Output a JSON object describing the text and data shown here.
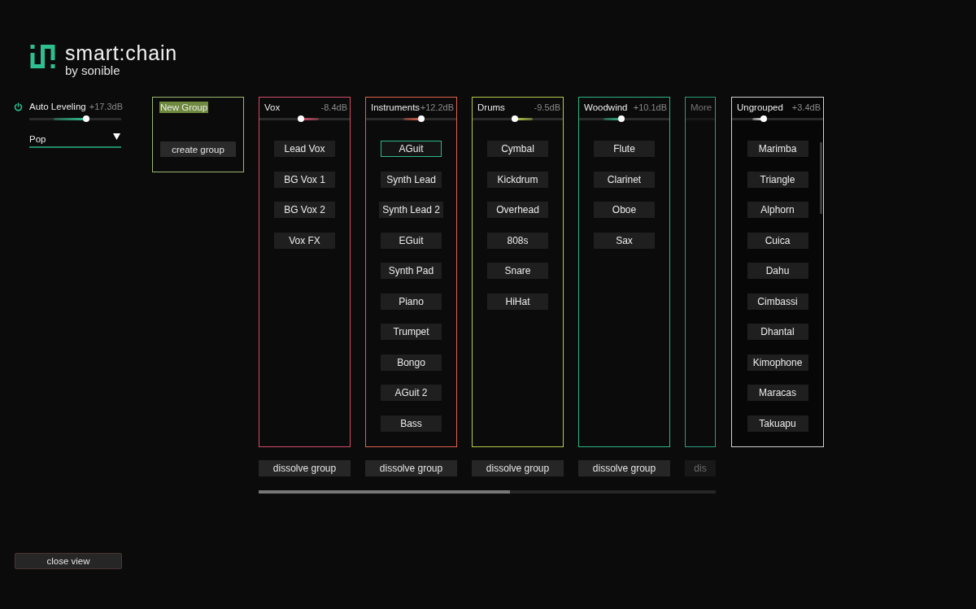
{
  "logo": {
    "title": "smart:chain",
    "byline": "by sonible"
  },
  "auto_leveling": {
    "label": "Auto Leveling",
    "on": true,
    "reading": "+17.3dB",
    "level": 0.62,
    "trail_left": true
  },
  "preset": {
    "value": "Pop"
  },
  "new_group": {
    "name": "New Group",
    "name_highlighted": true,
    "button": "create group"
  },
  "groups": [
    {
      "name": "Vox",
      "reading": "-8.4dB",
      "level": 0.46,
      "trail_left": false,
      "color": "#d04e68",
      "items": [
        {
          "label": "Lead Vox",
          "selected": false
        },
        {
          "label": "BG Vox 1",
          "selected": false
        },
        {
          "label": "BG Vox 2",
          "selected": false
        },
        {
          "label": "Vox FX",
          "selected": false
        }
      ],
      "dissolve": "dissolve group"
    },
    {
      "name": "Instruments",
      "reading": "+12.2dB",
      "level": 0.61,
      "trail_left": true,
      "color": "#e0604c",
      "items": [
        {
          "label": "AGuit",
          "selected": true
        },
        {
          "label": "Synth Lead",
          "selected": false
        },
        {
          "label": "Synth Lead 2",
          "selected": false
        },
        {
          "label": "EGuit",
          "selected": false
        },
        {
          "label": "Synth Pad",
          "selected": false
        },
        {
          "label": "Piano",
          "selected": false
        },
        {
          "label": "Trumpet",
          "selected": false
        },
        {
          "label": "Bongo",
          "selected": false
        },
        {
          "label": "AGuit 2",
          "selected": false
        },
        {
          "label": "Bass",
          "selected": false
        }
      ],
      "dissolve": "dissolve group"
    },
    {
      "name": "Drums",
      "reading": "-9.5dB",
      "level": 0.47,
      "trail_left": false,
      "color": "#b4cc4c",
      "items": [
        {
          "label": "Cymbal",
          "selected": false
        },
        {
          "label": "Kickdrum",
          "selected": false
        },
        {
          "label": "Overhead",
          "selected": false
        },
        {
          "label": "808s",
          "selected": false
        },
        {
          "label": "Snare",
          "selected": false
        },
        {
          "label": "HiHat",
          "selected": false
        }
      ],
      "dissolve": "dissolve group"
    },
    {
      "name": "Woodwind",
      "reading": "+10.1dB",
      "level": 0.47,
      "trail_left": true,
      "color": "#2fb489",
      "items": [
        {
          "label": "Flute",
          "selected": false
        },
        {
          "label": "Clarinet",
          "selected": false
        },
        {
          "label": "Oboe",
          "selected": false
        },
        {
          "label": "Sax",
          "selected": false
        }
      ],
      "dissolve": "dissolve group"
    },
    {
      "name": "More",
      "color": "#2a9e7c",
      "dissolve": "dis"
    }
  ],
  "ungrouped": {
    "name": "Ungrouped",
    "reading": "+3.4dB",
    "level": 0.35,
    "trail_left": true,
    "items": [
      {
        "label": "Marimba",
        "selected": false
      },
      {
        "label": "Triangle",
        "selected": false
      },
      {
        "label": "Alphorn",
        "selected": false
      },
      {
        "label": "Cuica",
        "selected": false
      },
      {
        "label": "Dahu",
        "selected": false
      },
      {
        "label": "Cimbassi",
        "selected": false
      },
      {
        "label": "Dhantal",
        "selected": false
      },
      {
        "label": "Kimophone",
        "selected": false
      },
      {
        "label": "Maracas",
        "selected": false
      },
      {
        "label": "Takuapu",
        "selected": false
      }
    ]
  },
  "close_button": "close view"
}
